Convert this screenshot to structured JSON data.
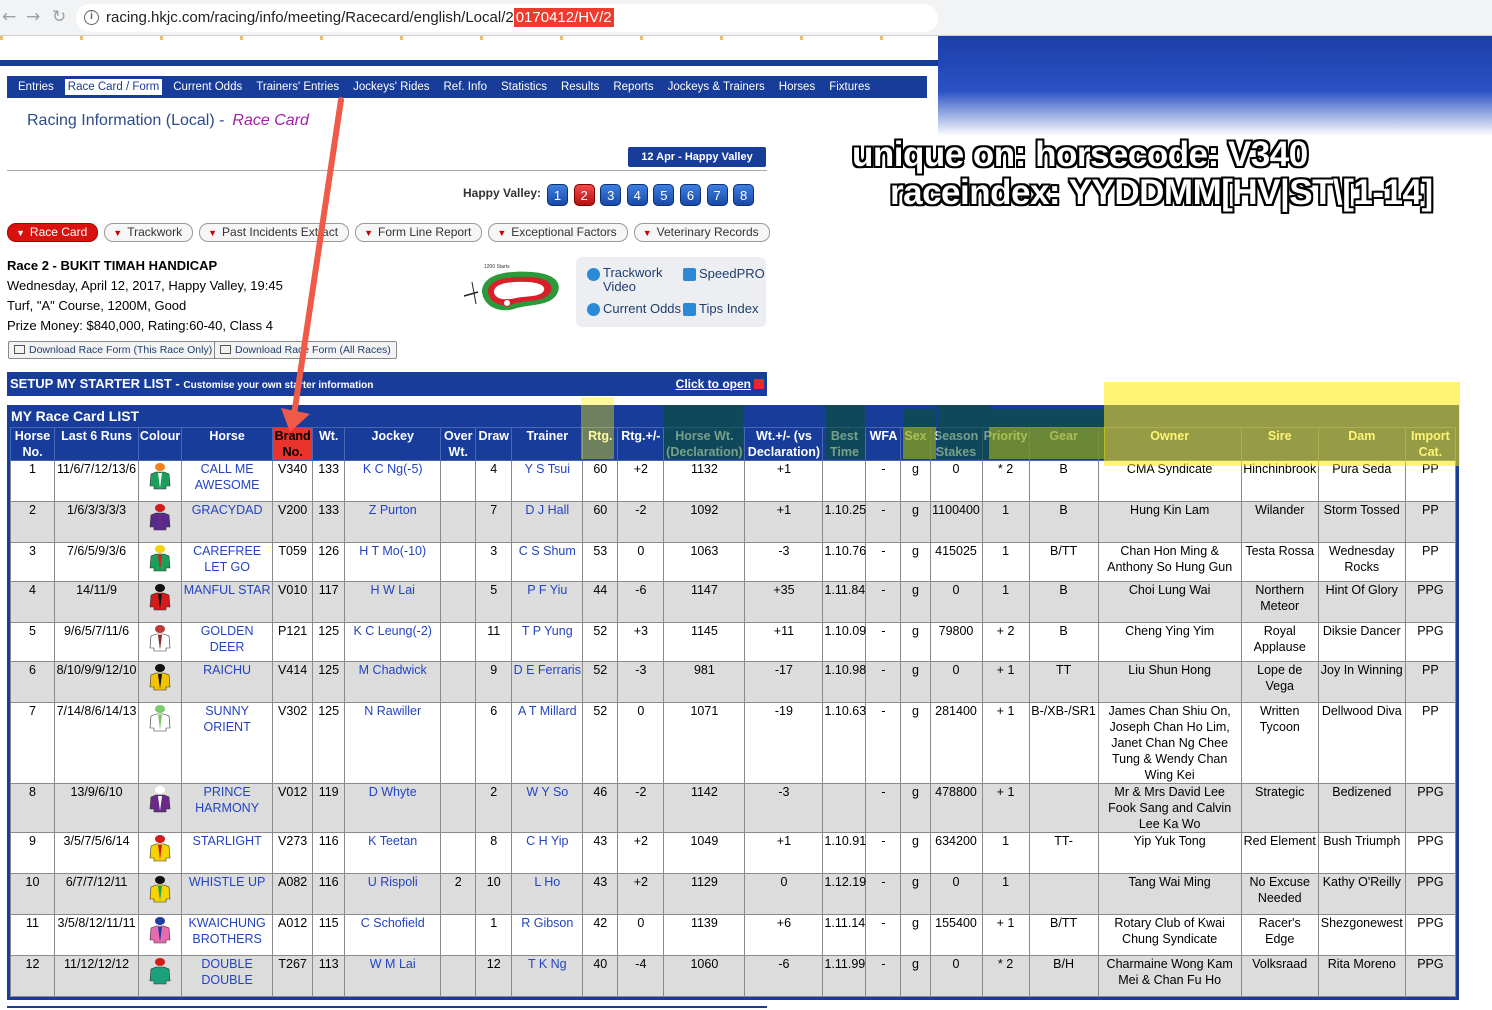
{
  "browser": {
    "url_prefix": "racing.hkjc.com/racing/info/meeting/Racecard/english/Local/2",
    "url_highlight": "0170412/HV/2"
  },
  "annotation": {
    "line1": "unique on: horsecode: V340",
    "line2": "raceindex: YYDDMM[HV|ST\\[1-14]"
  },
  "nav": {
    "items": [
      "Entries",
      "Race Card / Form",
      "Current Odds",
      "Trainers' Entries",
      "Jockeys' Rides",
      "Ref. Info",
      "Statistics",
      "Results",
      "Reports",
      "Jockeys & Trainers",
      "Horses",
      "Fixtures"
    ],
    "active": "Race Card / Form"
  },
  "heading": {
    "main": "Racing Information (Local) -",
    "sub": "Race Card"
  },
  "meeting_badge": "12 Apr - Happy Valley",
  "venue_label": "Happy Valley:",
  "race_numbers": [
    "1",
    "2",
    "3",
    "4",
    "5",
    "6",
    "7",
    "8"
  ],
  "selected_race": "2",
  "subtabs": [
    "Race Card",
    "Trackwork",
    "Past Incidents Extract",
    "Form Line Report",
    "Exceptional Factors",
    "Veterinary Records"
  ],
  "race": {
    "title": "Race 2 - BUKIT TIMAH HANDICAP",
    "line1": "Wednesday, April 12, 2017, Happy Valley, 19:45",
    "line2": "Turf, \"A\" Course, 1200M, Good",
    "line3": "Prize Money: $840,000, Rating:60-40, Class 4"
  },
  "track_label": "1200 Starts",
  "tools": {
    "trackwork_video": "Trackwork\nVideo",
    "speedpro": "SpeedPRO",
    "current_odds": "Current Odds",
    "tips_index": "Tips Index"
  },
  "downloads": {
    "this_race": "Download Race Form (This Race Only)",
    "all_races": "Download Race Form (All Races)"
  },
  "setup": {
    "title": "SETUP MY STARTER LIST -",
    "subtitle": "Customise your own starter information",
    "open": "Click to open"
  },
  "racecard": {
    "title": "MY Race Card LIST",
    "columns": [
      "Horse No.",
      "Last 6 Runs",
      "Colour",
      "Horse",
      "Brand No.",
      "Wt.",
      "Jockey",
      "Over Wt.",
      "Draw",
      "Trainer",
      "Rtg.",
      "Rtg.+/-",
      "Horse Wt. (Declaration)",
      "Wt.+/- (vs Declaration)",
      "Best Time",
      "WFA",
      "Sex",
      "Season Stakes",
      "Priority",
      "Gear",
      "Owner",
      "Sire",
      "Dam",
      "Import Cat."
    ],
    "rows": [
      {
        "no": "1",
        "last6": "11/6/7/12/13/6",
        "horse": "CALL ME AWESOME",
        "brand": "V340",
        "wt": "133",
        "jockey": "K C Ng(-5)",
        "overwt": "",
        "draw": "4",
        "trainer": "Y S Tsui",
        "rtg": "60",
        "rtgchg": "+2",
        "hwt": "1132",
        "wtchg": "+1",
        "best": "",
        "wfa": "-",
        "sex": "g",
        "stakes": "0",
        "priority": "* 2",
        "gear": "B",
        "owner": "CMA Syndicate",
        "sire": "Hinchinbrook",
        "dam": "Pura Seda",
        "imp": "PP"
      },
      {
        "no": "2",
        "last6": "1/6/3/3/3/3",
        "horse": "GRACYDAD",
        "brand": "V200",
        "wt": "133",
        "jockey": "Z Purton",
        "overwt": "",
        "draw": "7",
        "trainer": "D J Hall",
        "rtg": "60",
        "rtgchg": "-2",
        "hwt": "1092",
        "wtchg": "+1",
        "best": "1.10.25",
        "wfa": "-",
        "sex": "g",
        "stakes": "1100400",
        "priority": "1",
        "gear": "B",
        "owner": "Hung Kin Lam",
        "sire": "Wilander",
        "dam": "Storm Tossed",
        "imp": "PP"
      },
      {
        "no": "3",
        "last6": "7/6/5/9/3/6",
        "horse": "CAREFREE LET GO",
        "brand": "T059",
        "wt": "126",
        "jockey": "H T Mo(-10)",
        "overwt": "",
        "draw": "3",
        "trainer": "C S Shum",
        "rtg": "53",
        "rtgchg": "0",
        "hwt": "1063",
        "wtchg": "-3",
        "best": "1.10.76",
        "wfa": "-",
        "sex": "g",
        "stakes": "415025",
        "priority": "1",
        "gear": "B/TT",
        "owner": "Chan Hon Ming & Anthony So Hung Gun",
        "sire": "Testa Rossa",
        "dam": "Wednesday Rocks",
        "imp": "PP"
      },
      {
        "no": "4",
        "last6": "14/11/9",
        "horse": "MANFUL STAR",
        "brand": "V010",
        "wt": "117",
        "jockey": "H W Lai",
        "overwt": "",
        "draw": "5",
        "trainer": "P F Yiu",
        "rtg": "44",
        "rtgchg": "-6",
        "hwt": "1147",
        "wtchg": "+35",
        "best": "1.11.84",
        "wfa": "-",
        "sex": "g",
        "stakes": "0",
        "priority": "1",
        "gear": "B",
        "owner": "Choi Lung Wai",
        "sire": "Northern Meteor",
        "dam": "Hint Of Glory",
        "imp": "PPG"
      },
      {
        "no": "5",
        "last6": "9/6/5/7/11/6",
        "horse": "GOLDEN DEER",
        "brand": "P121",
        "wt": "125",
        "jockey": "K C Leung(-2)",
        "overwt": "",
        "draw": "11",
        "trainer": "T P Yung",
        "rtg": "52",
        "rtgchg": "+3",
        "hwt": "1145",
        "wtchg": "+11",
        "best": "1.10.09",
        "wfa": "-",
        "sex": "g",
        "stakes": "79800",
        "priority": "+ 2",
        "gear": "B",
        "owner": "Cheng Ying Yim",
        "sire": "Royal Applause",
        "dam": "Diksie Dancer",
        "imp": "PPG"
      },
      {
        "no": "6",
        "last6": "8/10/9/9/12/10",
        "horse": "RAICHU",
        "brand": "V414",
        "wt": "125",
        "jockey": "M Chadwick",
        "overwt": "",
        "draw": "9",
        "trainer": "D E Ferraris",
        "rtg": "52",
        "rtgchg": "-3",
        "hwt": "981",
        "wtchg": "-17",
        "best": "1.10.98",
        "wfa": "-",
        "sex": "g",
        "stakes": "0",
        "priority": "+ 1",
        "gear": "TT",
        "owner": "Liu Shun Hong",
        "sire": "Lope de Vega",
        "dam": "Joy In Winning",
        "imp": "PP"
      },
      {
        "no": "7",
        "last6": "7/14/8/6/14/13",
        "horse": "SUNNY ORIENT",
        "brand": "V302",
        "wt": "125",
        "jockey": "N Rawiller",
        "overwt": "",
        "draw": "6",
        "trainer": "A T Millard",
        "rtg": "52",
        "rtgchg": "0",
        "hwt": "1071",
        "wtchg": "-19",
        "best": "1.10.63",
        "wfa": "-",
        "sex": "g",
        "stakes": "281400",
        "priority": "+ 1",
        "gear": "B-/XB-/SR1",
        "owner": "James Chan Shiu On, Joseph Chan Ho Lim, Janet Chan Ng Chee Tung & Wendy Chan Wing Kei",
        "sire": "Written Tycoon",
        "dam": "Dellwood Diva",
        "imp": "PP"
      },
      {
        "no": "8",
        "last6": "13/9/6/10",
        "horse": "PRINCE HARMONY",
        "brand": "V012",
        "wt": "119",
        "jockey": "D Whyte",
        "overwt": "",
        "draw": "2",
        "trainer": "W Y So",
        "rtg": "46",
        "rtgchg": "-2",
        "hwt": "1142",
        "wtchg": "-3",
        "best": "",
        "wfa": "-",
        "sex": "g",
        "stakes": "478800",
        "priority": "+ 1",
        "gear": "",
        "owner": "Mr & Mrs David Lee Fook Sang and Calvin Lee Ka Wo",
        "sire": "Strategic",
        "dam": "Bedizened",
        "imp": "PPG"
      },
      {
        "no": "9",
        "last6": "3/5/7/5/6/14",
        "horse": "STARLIGHT",
        "brand": "V273",
        "wt": "116",
        "jockey": "K Teetan",
        "overwt": "",
        "draw": "8",
        "trainer": "C H Yip",
        "rtg": "43",
        "rtgchg": "+2",
        "hwt": "1049",
        "wtchg": "+1",
        "best": "1.10.91",
        "wfa": "-",
        "sex": "g",
        "stakes": "634200",
        "priority": "1",
        "gear": "TT-",
        "owner": "Yip Yuk Tong",
        "sire": "Red Element",
        "dam": "Bush Triumph",
        "imp": "PPG"
      },
      {
        "no": "10",
        "last6": "6/7/7/12/11",
        "horse": "WHISTLE UP",
        "brand": "A082",
        "wt": "116",
        "jockey": "U Rispoli",
        "overwt": "2",
        "draw": "10",
        "trainer": "L Ho",
        "rtg": "43",
        "rtgchg": "+2",
        "hwt": "1129",
        "wtchg": "0",
        "best": "1.12.19",
        "wfa": "-",
        "sex": "g",
        "stakes": "0",
        "priority": "1",
        "gear": "",
        "owner": "Tang Wai Ming",
        "sire": "No Excuse Needed",
        "dam": "Kathy O'Reilly",
        "imp": "PPG"
      },
      {
        "no": "11",
        "last6": "3/5/8/12/11/11",
        "horse": "KWAICHUNG BROTHERS",
        "brand": "A012",
        "wt": "115",
        "jockey": "C Schofield",
        "overwt": "",
        "draw": "1",
        "trainer": "R Gibson",
        "rtg": "42",
        "rtgchg": "0",
        "hwt": "1139",
        "wtchg": "+6",
        "best": "1.11.14",
        "wfa": "-",
        "sex": "g",
        "stakes": "155400",
        "priority": "+ 1",
        "gear": "B/TT",
        "owner": "Rotary Club of Kwai Chung Syndicate",
        "sire": "Racer's Edge",
        "dam": "Shezgonewest",
        "imp": "PPG"
      },
      {
        "no": "12",
        "last6": "11/12/12/12",
        "horse": "DOUBLE DOUBLE",
        "brand": "T267",
        "wt": "113",
        "jockey": "W M Lai",
        "overwt": "",
        "draw": "12",
        "trainer": "T K Ng",
        "rtg": "40",
        "rtgchg": "-4",
        "hwt": "1060",
        "wtchg": "-6",
        "best": "1.11.99",
        "wfa": "-",
        "sex": "g",
        "stakes": "0",
        "priority": "* 2",
        "gear": "B/H",
        "owner": "Charmaine Wong Kam Mei & Chan Fu Ho",
        "sire": "Volksraad",
        "dam": "Rita Moreno",
        "imp": "PPG"
      }
    ]
  },
  "silk_colors": [
    [
      "#f0821e",
      "#1aa05a",
      "#ffffff"
    ],
    [
      "#d31b1b",
      "#5a2a8a",
      "#6a2a8a"
    ],
    [
      "#f5d400",
      "#1aa05a",
      "#e01b1b"
    ],
    [
      "#111111",
      "#d31b1b",
      "#111111"
    ],
    [
      "#c23a3a",
      "#ffffff",
      "#8a2a2a"
    ],
    [
      "#111111",
      "#f2c400",
      "#111111"
    ],
    [
      "#7acb6a",
      "#ffffff",
      "#7acb6a"
    ],
    [
      "#ffffff",
      "#6a2a8a",
      "#ffffff"
    ],
    [
      "#d31b1b",
      "#f5d400",
      "#d31b1b"
    ],
    [
      "#111111",
      "#f5d400",
      "#1aa05a"
    ],
    [
      "#1f3fa0",
      "#e86ab0",
      "#1f3fa0"
    ],
    [
      "#d31b1b",
      "#1aa07a",
      "#1aa07a"
    ]
  ],
  "colors": {
    "brand_blue": "#173c9a",
    "accent_red": "#e8342c",
    "link_blue": "#2343c2",
    "row_alt": "#dcdcdc"
  }
}
